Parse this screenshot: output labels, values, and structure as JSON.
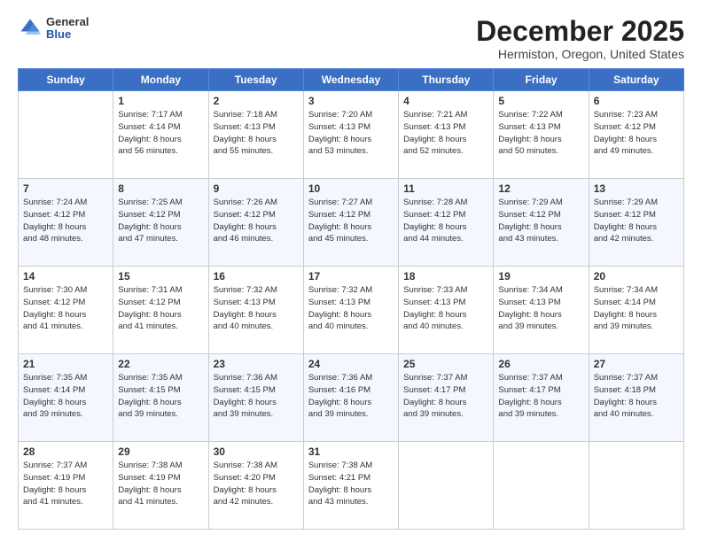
{
  "logo": {
    "general": "General",
    "blue": "Blue"
  },
  "header": {
    "month": "December 2025",
    "location": "Hermiston, Oregon, United States"
  },
  "days_of_week": [
    "Sunday",
    "Monday",
    "Tuesday",
    "Wednesday",
    "Thursday",
    "Friday",
    "Saturday"
  ],
  "weeks": [
    [
      {
        "day": "",
        "info": ""
      },
      {
        "day": "1",
        "info": "Sunrise: 7:17 AM\nSunset: 4:14 PM\nDaylight: 8 hours\nand 56 minutes."
      },
      {
        "day": "2",
        "info": "Sunrise: 7:18 AM\nSunset: 4:13 PM\nDaylight: 8 hours\nand 55 minutes."
      },
      {
        "day": "3",
        "info": "Sunrise: 7:20 AM\nSunset: 4:13 PM\nDaylight: 8 hours\nand 53 minutes."
      },
      {
        "day": "4",
        "info": "Sunrise: 7:21 AM\nSunset: 4:13 PM\nDaylight: 8 hours\nand 52 minutes."
      },
      {
        "day": "5",
        "info": "Sunrise: 7:22 AM\nSunset: 4:13 PM\nDaylight: 8 hours\nand 50 minutes."
      },
      {
        "day": "6",
        "info": "Sunrise: 7:23 AM\nSunset: 4:12 PM\nDaylight: 8 hours\nand 49 minutes."
      }
    ],
    [
      {
        "day": "7",
        "info": "Sunrise: 7:24 AM\nSunset: 4:12 PM\nDaylight: 8 hours\nand 48 minutes."
      },
      {
        "day": "8",
        "info": "Sunrise: 7:25 AM\nSunset: 4:12 PM\nDaylight: 8 hours\nand 47 minutes."
      },
      {
        "day": "9",
        "info": "Sunrise: 7:26 AM\nSunset: 4:12 PM\nDaylight: 8 hours\nand 46 minutes."
      },
      {
        "day": "10",
        "info": "Sunrise: 7:27 AM\nSunset: 4:12 PM\nDaylight: 8 hours\nand 45 minutes."
      },
      {
        "day": "11",
        "info": "Sunrise: 7:28 AM\nSunset: 4:12 PM\nDaylight: 8 hours\nand 44 minutes."
      },
      {
        "day": "12",
        "info": "Sunrise: 7:29 AM\nSunset: 4:12 PM\nDaylight: 8 hours\nand 43 minutes."
      },
      {
        "day": "13",
        "info": "Sunrise: 7:29 AM\nSunset: 4:12 PM\nDaylight: 8 hours\nand 42 minutes."
      }
    ],
    [
      {
        "day": "14",
        "info": "Sunrise: 7:30 AM\nSunset: 4:12 PM\nDaylight: 8 hours\nand 41 minutes."
      },
      {
        "day": "15",
        "info": "Sunrise: 7:31 AM\nSunset: 4:12 PM\nDaylight: 8 hours\nand 41 minutes."
      },
      {
        "day": "16",
        "info": "Sunrise: 7:32 AM\nSunset: 4:13 PM\nDaylight: 8 hours\nand 40 minutes."
      },
      {
        "day": "17",
        "info": "Sunrise: 7:32 AM\nSunset: 4:13 PM\nDaylight: 8 hours\nand 40 minutes."
      },
      {
        "day": "18",
        "info": "Sunrise: 7:33 AM\nSunset: 4:13 PM\nDaylight: 8 hours\nand 40 minutes."
      },
      {
        "day": "19",
        "info": "Sunrise: 7:34 AM\nSunset: 4:13 PM\nDaylight: 8 hours\nand 39 minutes."
      },
      {
        "day": "20",
        "info": "Sunrise: 7:34 AM\nSunset: 4:14 PM\nDaylight: 8 hours\nand 39 minutes."
      }
    ],
    [
      {
        "day": "21",
        "info": "Sunrise: 7:35 AM\nSunset: 4:14 PM\nDaylight: 8 hours\nand 39 minutes."
      },
      {
        "day": "22",
        "info": "Sunrise: 7:35 AM\nSunset: 4:15 PM\nDaylight: 8 hours\nand 39 minutes."
      },
      {
        "day": "23",
        "info": "Sunrise: 7:36 AM\nSunset: 4:15 PM\nDaylight: 8 hours\nand 39 minutes."
      },
      {
        "day": "24",
        "info": "Sunrise: 7:36 AM\nSunset: 4:16 PM\nDaylight: 8 hours\nand 39 minutes."
      },
      {
        "day": "25",
        "info": "Sunrise: 7:37 AM\nSunset: 4:17 PM\nDaylight: 8 hours\nand 39 minutes."
      },
      {
        "day": "26",
        "info": "Sunrise: 7:37 AM\nSunset: 4:17 PM\nDaylight: 8 hours\nand 39 minutes."
      },
      {
        "day": "27",
        "info": "Sunrise: 7:37 AM\nSunset: 4:18 PM\nDaylight: 8 hours\nand 40 minutes."
      }
    ],
    [
      {
        "day": "28",
        "info": "Sunrise: 7:37 AM\nSunset: 4:19 PM\nDaylight: 8 hours\nand 41 minutes."
      },
      {
        "day": "29",
        "info": "Sunrise: 7:38 AM\nSunset: 4:19 PM\nDaylight: 8 hours\nand 41 minutes."
      },
      {
        "day": "30",
        "info": "Sunrise: 7:38 AM\nSunset: 4:20 PM\nDaylight: 8 hours\nand 42 minutes."
      },
      {
        "day": "31",
        "info": "Sunrise: 7:38 AM\nSunset: 4:21 PM\nDaylight: 8 hours\nand 43 minutes."
      },
      {
        "day": "",
        "info": ""
      },
      {
        "day": "",
        "info": ""
      },
      {
        "day": "",
        "info": ""
      }
    ]
  ]
}
